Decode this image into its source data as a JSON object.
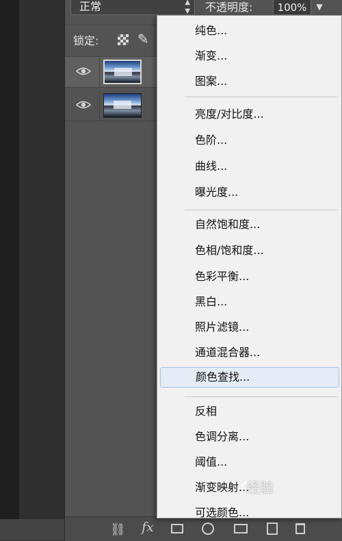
{
  "blend_mode": {
    "value": "正常"
  },
  "opacity": {
    "label": "不透明度:",
    "value": "100%"
  },
  "lock": {
    "label": "锁定:"
  },
  "menu": {
    "items": [
      {
        "label": "纯色..."
      },
      {
        "label": "渐变..."
      },
      {
        "label": "图案..."
      },
      {
        "label": "亮度/对比度..."
      },
      {
        "label": "色阶..."
      },
      {
        "label": "曲线..."
      },
      {
        "label": "曝光度..."
      },
      {
        "label": "自然饱和度..."
      },
      {
        "label": "色相/饱和度..."
      },
      {
        "label": "色彩平衡..."
      },
      {
        "label": "黑白..."
      },
      {
        "label": "照片滤镜..."
      },
      {
        "label": "通道混合器..."
      },
      {
        "label": "颜色查找..."
      },
      {
        "label": "反相"
      },
      {
        "label": "色调分离..."
      },
      {
        "label": "阈值..."
      },
      {
        "label": "渐变映射..."
      },
      {
        "label": "可选颜色..."
      }
    ],
    "highlighted": "颜色查找..."
  },
  "bottom_bar": {
    "fx_label": "fx"
  },
  "watermark": {
    "text": "经验"
  },
  "colors": {
    "panel": "#535353",
    "menu_bg": "#f1f1f1",
    "highlight": "#e3ecf7"
  }
}
